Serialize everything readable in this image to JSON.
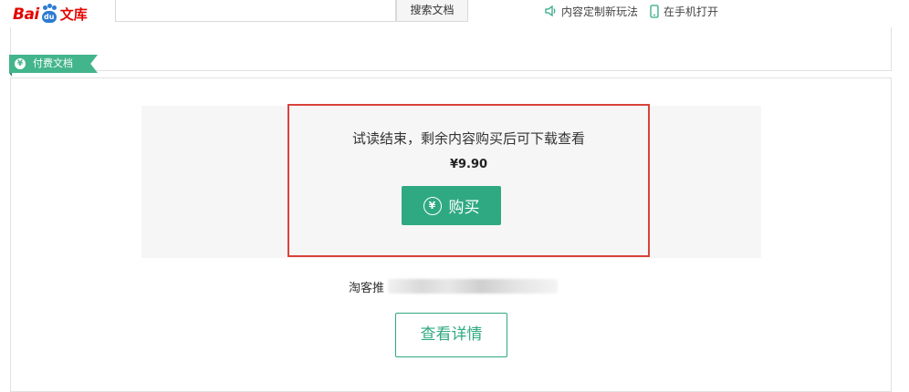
{
  "header": {
    "logo": {
      "bai": "Bai",
      "du": "du",
      "wenku": "文库"
    },
    "search": {
      "value": "",
      "button_label": "搜索文档"
    },
    "links": [
      {
        "label": "内容定制新玩法",
        "icon": "speaker-icon"
      },
      {
        "label": "在手机打开",
        "icon": "phone-icon"
      }
    ]
  },
  "tag": {
    "coin": "¥",
    "label": "付费文档"
  },
  "purchase": {
    "message": "试读结束，剩余内容购买后可下载查看",
    "price": "¥9.90",
    "buy_icon": "¥",
    "buy_label": "购买"
  },
  "recommend": {
    "prefix": "淘客推"
  },
  "detail": {
    "label": "查看详情"
  },
  "colors": {
    "brand_red": "#e10601",
    "brand_blue": "#2d7bd3",
    "accent_green": "#2fa982",
    "tag_green": "#43b58c",
    "highlight_red": "#d9423a"
  }
}
